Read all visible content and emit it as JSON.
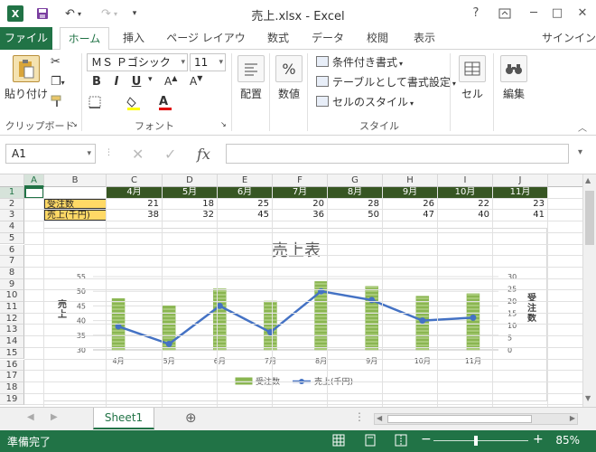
{
  "window": {
    "title": "売上.xlsx - Excel",
    "help": "?",
    "minimize": "─",
    "restore": "□",
    "close": "✕",
    "signin": "サインイン"
  },
  "ribbon": {
    "tabs": [
      "ファイル",
      "ホーム",
      "挿入",
      "ページ レイアウト",
      "数式",
      "データ",
      "校閲",
      "表示"
    ],
    "clipboard": {
      "paste": "貼り付け",
      "label": "クリップボード"
    },
    "font": {
      "name": "ＭＳ Ｐゴシック",
      "size": "11",
      "bold": "B",
      "italic": "I",
      "underline": "U",
      "label": "フォント"
    },
    "alignment": {
      "label": "配置"
    },
    "number": {
      "label": "数値",
      "symbol": "%"
    },
    "styles": {
      "conditional": "条件付き書式",
      "table": "テーブルとして書式設定",
      "cell": "セルのスタイル",
      "label": "スタイル"
    },
    "cells": {
      "label": "セル"
    },
    "editing": {
      "label": "編集"
    }
  },
  "formula_bar": {
    "name_box": "A1",
    "fx": "fx",
    "value": ""
  },
  "grid": {
    "columns": [
      "A",
      "B",
      "C",
      "D",
      "E",
      "F",
      "G",
      "H",
      "I",
      "J"
    ],
    "rows": [
      "1",
      "2",
      "3",
      "4",
      "5",
      "6",
      "7",
      "8",
      "9",
      "10",
      "11",
      "12",
      "13",
      "14",
      "15",
      "16",
      "17",
      "18",
      "19"
    ],
    "header_row": [
      "4月",
      "5月",
      "6月",
      "7月",
      "8月",
      "9月",
      "10月",
      "11月"
    ],
    "row2_label": "受注数",
    "row2": [
      "21",
      "18",
      "25",
      "20",
      "28",
      "26",
      "22",
      "23"
    ],
    "row3_label": "売上(千円)",
    "row3": [
      "38",
      "32",
      "45",
      "36",
      "50",
      "47",
      "40",
      "41"
    ]
  },
  "chart_data": {
    "type": "bar",
    "title": "売上表",
    "categories": [
      "4月",
      "5月",
      "6月",
      "7月",
      "8月",
      "9月",
      "10月",
      "11月"
    ],
    "series": [
      {
        "name": "受注数",
        "kind": "bar",
        "axis": "right",
        "values": [
          21,
          18,
          25,
          20,
          28,
          26,
          22,
          23
        ]
      },
      {
        "name": "売上(千円)",
        "kind": "line",
        "axis": "left",
        "values": [
          38,
          32,
          45,
          36,
          50,
          47,
          40,
          41
        ]
      }
    ],
    "ylabel": "売上",
    "y2label": "受注数",
    "ylim": [
      30,
      55
    ],
    "yticks": [
      "30",
      "35",
      "40",
      "45",
      "50",
      "55"
    ],
    "y2lim": [
      0,
      30
    ],
    "y2ticks": [
      "0",
      "5",
      "10",
      "15",
      "20",
      "25",
      "30"
    ],
    "legend_position": "bottom",
    "colors": {
      "bar": "#8ab651",
      "line": "#4472c4"
    }
  },
  "sheets": {
    "active": "Sheet1",
    "add": "⊕"
  },
  "status": {
    "text": "準備完了",
    "zoom": "85%"
  }
}
